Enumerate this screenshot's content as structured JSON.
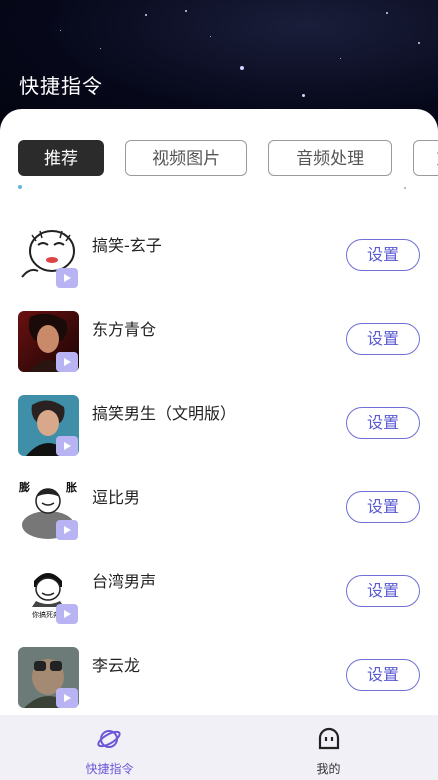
{
  "header": {
    "title": "快捷指令"
  },
  "tabs": [
    {
      "label": "推荐",
      "active": true
    },
    {
      "label": "视频图片",
      "active": false
    },
    {
      "label": "音频处理",
      "active": false
    },
    {
      "label": "方",
      "active": false
    }
  ],
  "items": [
    {
      "name": "搞笑-玄子",
      "button": "设置",
      "thumb_icon": "meme-cartoon-face"
    },
    {
      "name": "东方青仓",
      "button": "设置",
      "thumb_icon": "portrait-photo"
    },
    {
      "name": "搞笑男生（文明版）",
      "button": "设置",
      "thumb_icon": "portrait-photo"
    },
    {
      "name": "逗比男",
      "button": "设置",
      "thumb_icon": "meme-cartoon-face"
    },
    {
      "name": "台湾男声",
      "button": "设置",
      "thumb_icon": "meme-cartoon-face"
    },
    {
      "name": "李云龙",
      "button": "设置",
      "thumb_icon": "portrait-photo"
    }
  ],
  "thumb_texts": {
    "item4_left": "膨",
    "item4_right": "胀",
    "item5_caption": "你搞死奔"
  },
  "bottom_nav": [
    {
      "label": "快捷指令",
      "icon": "planet-icon",
      "active": true,
      "color": "#6a58d8"
    },
    {
      "label": "我的",
      "icon": "face-icon",
      "active": false,
      "color": "#333333"
    }
  ],
  "colors": {
    "accent": "#6a58d8",
    "play_badge": "#b8b4f4",
    "button_border": "#6f6fd6"
  }
}
